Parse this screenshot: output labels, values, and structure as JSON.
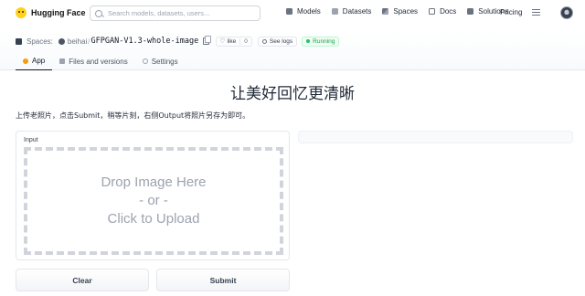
{
  "header": {
    "brand": "Hugging Face",
    "search_placeholder": "Search models, datasets, users...",
    "nav": [
      {
        "label": "Models",
        "icon": "models-icon"
      },
      {
        "label": "Datasets",
        "icon": "datasets-icon"
      },
      {
        "label": "Spaces",
        "icon": "spaces-icon"
      },
      {
        "label": "Docs",
        "icon": "docs-icon"
      },
      {
        "label": "Solutions",
        "icon": "solutions-icon"
      }
    ],
    "pricing": "Pricing"
  },
  "space": {
    "label": "Spaces:",
    "owner": "beihai",
    "separator": "/",
    "repo": "GFPGAN-V1.3-whole-image",
    "like_label": "like",
    "like_count": "0",
    "logs_label": "See logs",
    "status": "Running",
    "status_color": "#16a34a",
    "tabs": [
      {
        "label": "App",
        "active": true
      },
      {
        "label": "Files and versions",
        "active": false
      },
      {
        "label": "Settings",
        "active": false
      }
    ]
  },
  "app": {
    "title": "让美好回忆更清晰",
    "description": "上传老照片，点击Submit，稍等片刻，右侧Output将照片另存为即可。",
    "input_label": "Input",
    "dropzone_lines": [
      "Drop Image Here",
      "- or -",
      "Click to Upload"
    ],
    "clear_label": "Clear",
    "submit_label": "Submit"
  }
}
